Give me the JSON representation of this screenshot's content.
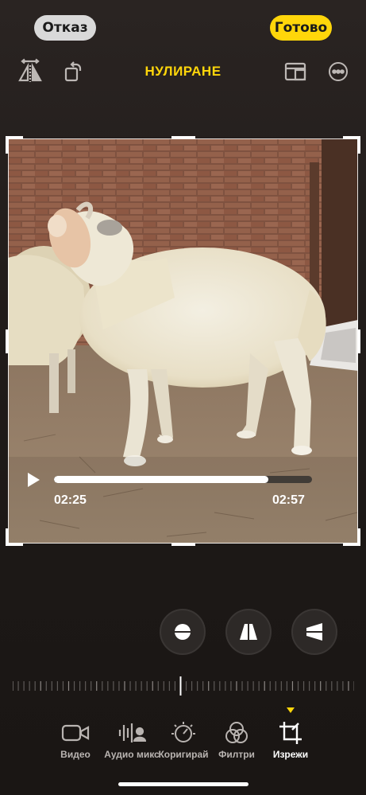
{
  "header": {
    "cancel_label": "Отказ",
    "done_label": "Готово",
    "title": "НУЛИРАНЕ"
  },
  "video": {
    "current_time": "02:25",
    "total_time": "02:57",
    "progress": 0.83
  },
  "tabs": [
    {
      "label": "Видео",
      "icon": "video-camera-icon"
    },
    {
      "label": "Аудио микс",
      "icon": "audio-mix-icon"
    },
    {
      "label": "Коригирай",
      "icon": "adjust-dial-icon"
    },
    {
      "label": "Филтри",
      "icon": "filters-icon"
    },
    {
      "label": "Изрежи",
      "icon": "crop-icon",
      "active": true
    }
  ],
  "colors": {
    "accent": "#ffd60a",
    "background": "#1f1a18"
  }
}
